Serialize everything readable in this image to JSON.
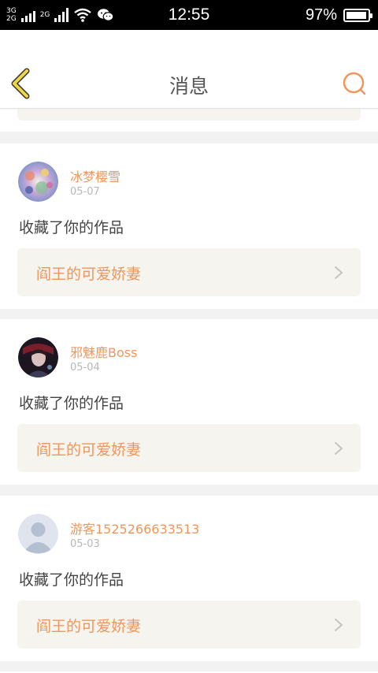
{
  "status_bar": {
    "network_top": "3G",
    "network_bottom": "2G",
    "network_2": "2G",
    "time": "12:55",
    "battery_percent": "97%",
    "battery_level": 0.97
  },
  "header": {
    "title": "消息"
  },
  "colors": {
    "accent": "#f0965c",
    "back_icon": "#f2d44b",
    "card_bg": "#f5f4ee"
  },
  "messages": [
    {
      "username": "冰梦樱雪",
      "date": "05-07",
      "action": "收藏了你的作品",
      "work_title": "阎王的可爱娇妻",
      "avatar": "colorful-anime-avatar"
    },
    {
      "username": "邪魅鹿Boss",
      "date": "05-04",
      "action": "收藏了你的作品",
      "work_title": "阎王的可爱娇妻",
      "avatar": "dark-portrait-avatar"
    },
    {
      "username": "游客1525266633513",
      "date": "05-03",
      "action": "收藏了你的作品",
      "work_title": "阎王的可爱娇妻",
      "avatar": "default-user-avatar"
    }
  ]
}
